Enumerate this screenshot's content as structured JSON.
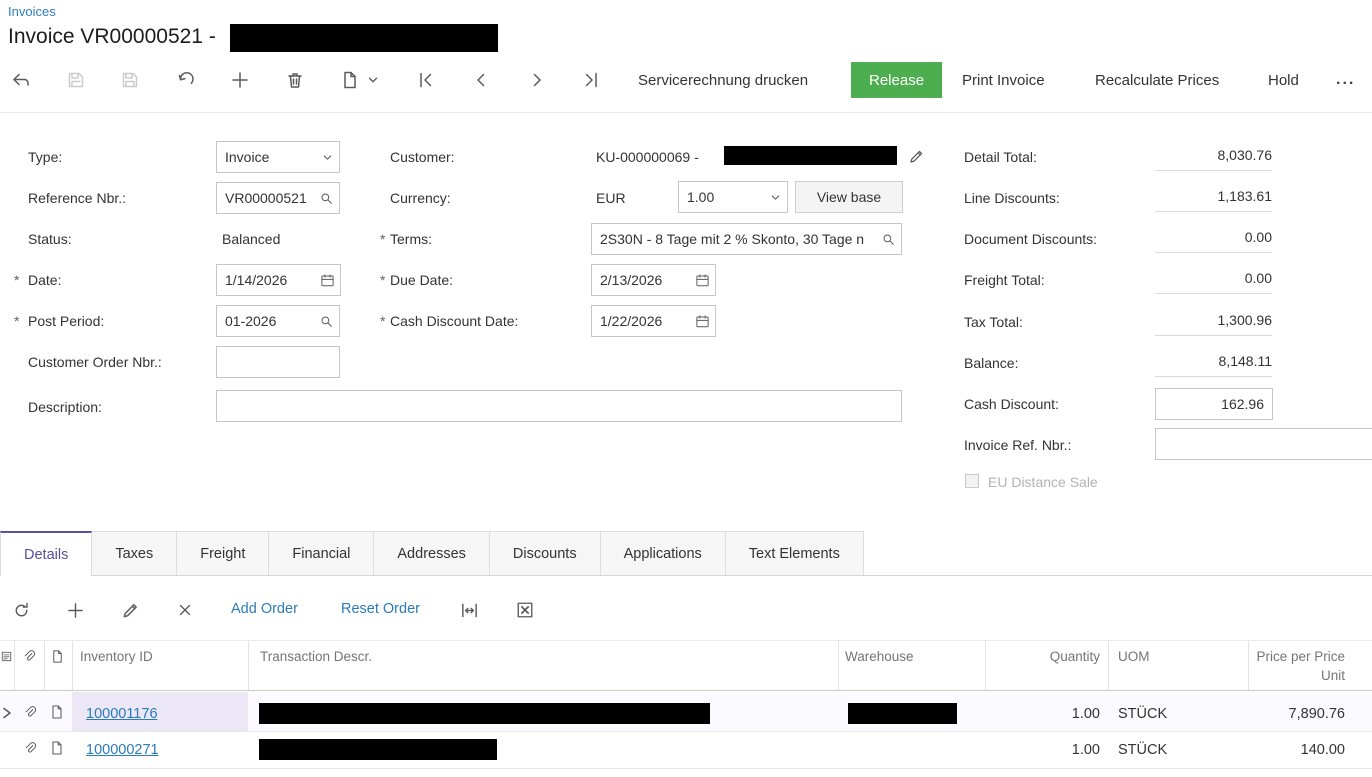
{
  "ui": {
    "required_marker": "*"
  },
  "header": {
    "breadcrumb": "Invoices",
    "title_prefix": "Invoice VR00000521 - "
  },
  "toolbar": {
    "service_print": "Servicerechnung drucken",
    "release": "Release",
    "print_invoice": "Print Invoice",
    "recalculate": "Recalculate Prices",
    "hold": "Hold",
    "more": "..."
  },
  "form": {
    "type_label": "Type:",
    "type_value": "Invoice",
    "reference_label": "Reference Nbr.:",
    "reference_value": "VR00000521",
    "status_label": "Status:",
    "status_value": "Balanced",
    "date_label": "Date:",
    "date_value": "1/14/2026",
    "post_period_label": "Post Period:",
    "post_period_value": "01-2026",
    "customer_order_label": "Customer Order Nbr.:",
    "customer_order_value": "",
    "description_label": "Description:",
    "description_value": "",
    "customer_label": "Customer:",
    "customer_value": "KU-000000069 - ",
    "currency_label": "Currency:",
    "currency_code": "EUR",
    "currency_rate": "1.00",
    "view_base": "View base",
    "terms_label": "Terms:",
    "terms_value": "2S30N - 8 Tage mit 2 % Skonto, 30 Tage n",
    "due_date_label": "Due Date:",
    "due_date_value": "2/13/2026",
    "cash_discount_date_label": "Cash Discount Date:",
    "cash_discount_date_value": "1/22/2026"
  },
  "totals": {
    "detail_total_label": "Detail Total:",
    "detail_total": "8,030.76",
    "line_discounts_label": "Line Discounts:",
    "line_discounts": "1,183.61",
    "document_discounts_label": "Document Discounts:",
    "document_discounts": "0.00",
    "freight_total_label": "Freight Total:",
    "freight_total": "0.00",
    "tax_total_label": "Tax Total:",
    "tax_total": "1,300.96",
    "balance_label": "Balance:",
    "balance": "8,148.11",
    "cash_discount_label": "Cash Discount:",
    "cash_discount": "162.96",
    "invoice_ref_label": "Invoice Ref. Nbr.:",
    "invoice_ref": "",
    "eu_distance_sale_label": "EU Distance Sale"
  },
  "tabs": {
    "items": [
      {
        "label": "Details"
      },
      {
        "label": "Taxes"
      },
      {
        "label": "Freight"
      },
      {
        "label": "Financial"
      },
      {
        "label": "Addresses"
      },
      {
        "label": "Discounts"
      },
      {
        "label": "Applications"
      },
      {
        "label": "Text Elements"
      }
    ]
  },
  "grid_toolbar": {
    "add_order": "Add Order",
    "reset_order": "Reset Order"
  },
  "grid": {
    "columns": {
      "inventory_id": "Inventory ID",
      "transaction_descr": "Transaction Descr.",
      "warehouse": "Warehouse",
      "quantity": "Quantity",
      "uom": "UOM",
      "price_line1": "Price per Price",
      "price_line2": "Unit"
    },
    "rows": [
      {
        "inventory_id": "100001176",
        "quantity": "1.00",
        "uom": "STÜCK",
        "price": "7,890.76"
      },
      {
        "inventory_id": "100000271",
        "quantity": "1.00",
        "uom": "STÜCK",
        "price": "140.00"
      }
    ]
  }
}
